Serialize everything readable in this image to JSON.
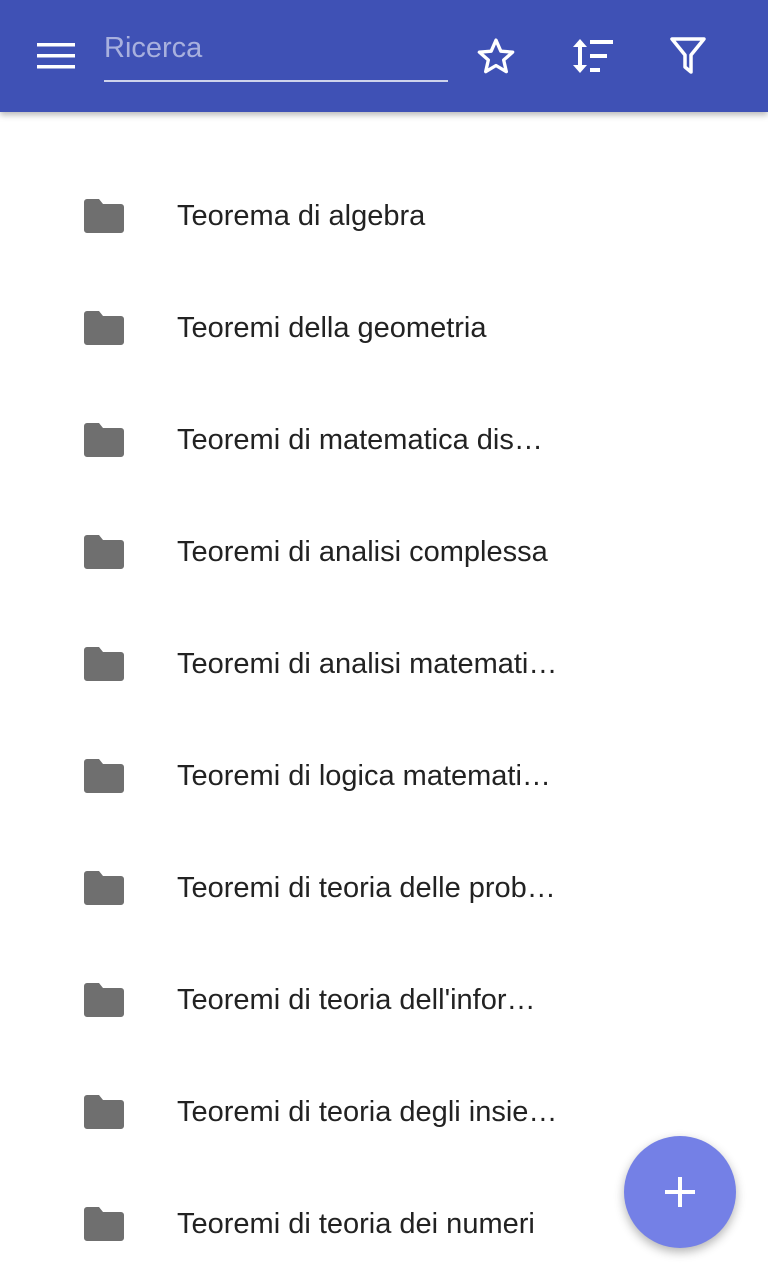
{
  "app_bar": {
    "menu_icon": "menu-icon",
    "search": {
      "placeholder": "Ricerca",
      "value": ""
    },
    "actions": [
      {
        "icon": "star-outline-icon"
      },
      {
        "icon": "sort-icon"
      },
      {
        "icon": "filter-icon"
      }
    ],
    "color": "#3f51b5"
  },
  "list": {
    "item_icon": "folder-icon",
    "items": [
      {
        "label": "Teorema di algebra"
      },
      {
        "label": "Teoremi della geometria"
      },
      {
        "label": "Teoremi di matematica dis…"
      },
      {
        "label": "Teoremi di analisi complessa"
      },
      {
        "label": "Teoremi di analisi matemati…"
      },
      {
        "label": "Teoremi di logica matemati…"
      },
      {
        "label": "Teoremi di teoria delle prob…"
      },
      {
        "label": "Teoremi di teoria dell'infor…"
      },
      {
        "label": "Teoremi di teoria degli insie…"
      },
      {
        "label": "Teoremi di teoria dei numeri"
      }
    ]
  },
  "fab": {
    "icon": "add-icon",
    "color": "#7480e6"
  }
}
